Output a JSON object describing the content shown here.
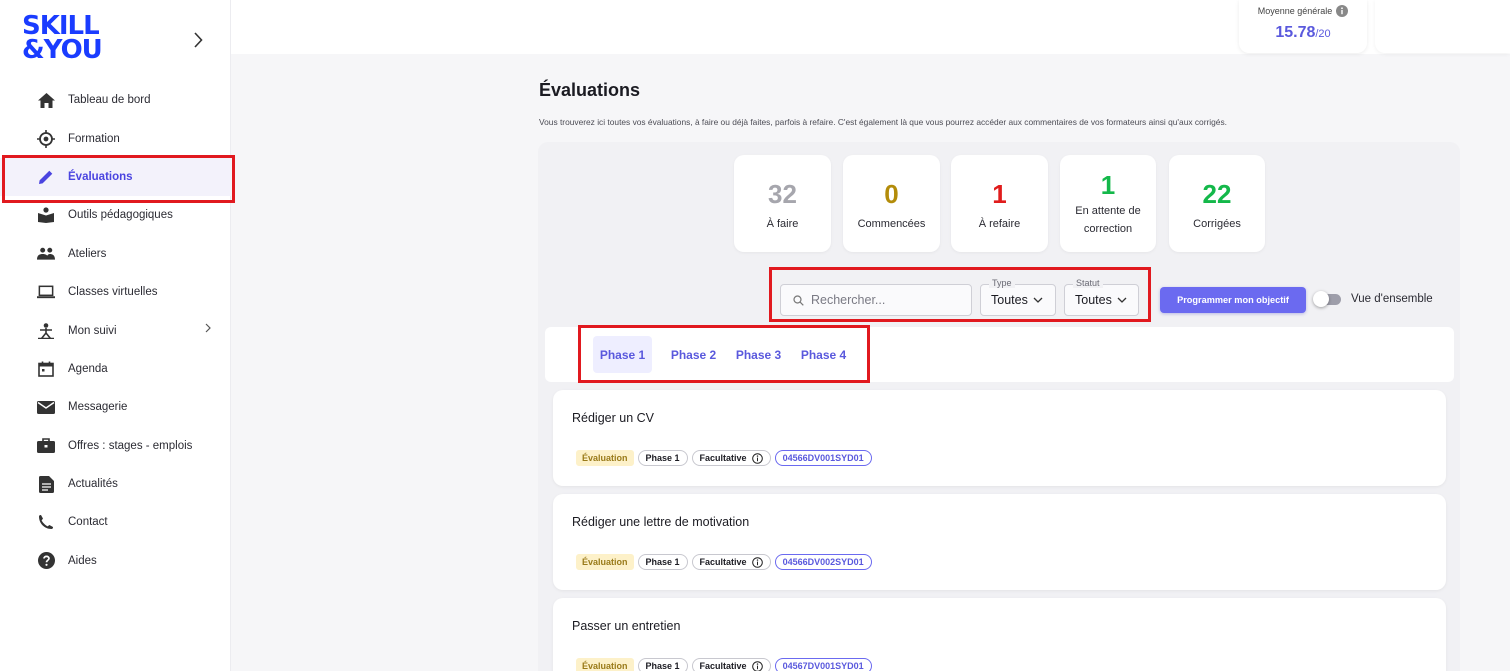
{
  "brand": {
    "line1": "SKILL",
    "line2": "&YOU",
    "color": "#1a3cff"
  },
  "sidebar": {
    "items": [
      {
        "label": "Tableau de bord",
        "icon": "home-icon"
      },
      {
        "label": "Formation",
        "icon": "target-icon"
      },
      {
        "label": "Évaluations",
        "icon": "pencil-icon",
        "active": true
      },
      {
        "label": "Outils pédagogiques",
        "icon": "book-reader-icon"
      },
      {
        "label": "Ateliers",
        "icon": "people-icon"
      },
      {
        "label": "Classes virtuelles",
        "icon": "laptop-icon"
      },
      {
        "label": "Mon suivi",
        "icon": "suivi-icon",
        "has_submenu": true
      },
      {
        "label": "Agenda",
        "icon": "calendar-icon"
      },
      {
        "label": "Messagerie",
        "icon": "mail-icon"
      },
      {
        "label": "Offres : stages - emplois",
        "icon": "briefcase-icon"
      },
      {
        "label": "Actualités",
        "icon": "news-icon"
      },
      {
        "label": "Contact",
        "icon": "phone-icon"
      },
      {
        "label": "Aides",
        "icon": "help-icon"
      }
    ]
  },
  "header": {
    "average": {
      "label": "Moyenne générale",
      "value": "15.78",
      "suffix": "/20"
    }
  },
  "page": {
    "title": "Évaluations",
    "description": "Vous trouverez ici toutes vos évaluations, à faire ou déjà faites, parfois à refaire. C'est également là que vous pourrez accéder aux commentaires de vos formateurs ainsi qu'aux corrigés."
  },
  "stats": [
    {
      "value": "32",
      "label": "À faire",
      "color": "#a6a6ad"
    },
    {
      "value": "0",
      "label": "Commencées",
      "color": "#b38c0a"
    },
    {
      "value": "1",
      "label": "À refaire",
      "color": "#e01c1c"
    },
    {
      "value": "1",
      "label": "En attente de correction",
      "color": "#14b84a"
    },
    {
      "value": "22",
      "label": "Corrigées",
      "color": "#14b84a"
    }
  ],
  "filters": {
    "search_placeholder": "Rechercher...",
    "type": {
      "label": "Type",
      "value": "Toutes"
    },
    "status": {
      "label": "Statut",
      "value": "Toutes"
    },
    "goal_button": "Programmer mon objectif",
    "overview_toggle": "Vue d'ensemble"
  },
  "tabs": [
    {
      "label": "Phase 1",
      "active": true
    },
    {
      "label": "Phase 2"
    },
    {
      "label": "Phase 3"
    },
    {
      "label": "Phase 4"
    }
  ],
  "evaluations": [
    {
      "title": "Rédiger un CV",
      "type": "Évaluation",
      "phase": "Phase 1",
      "optional": "Facultative",
      "code": "04566DV001SYD01"
    },
    {
      "title": "Rédiger une lettre de motivation",
      "type": "Évaluation",
      "phase": "Phase 1",
      "optional": "Facultative",
      "code": "04566DV002SYD01"
    },
    {
      "title": "Passer un entretien",
      "type": "Évaluation",
      "phase": "Phase 1",
      "optional": "Facultative",
      "code": "04567DV001SYD01"
    }
  ]
}
